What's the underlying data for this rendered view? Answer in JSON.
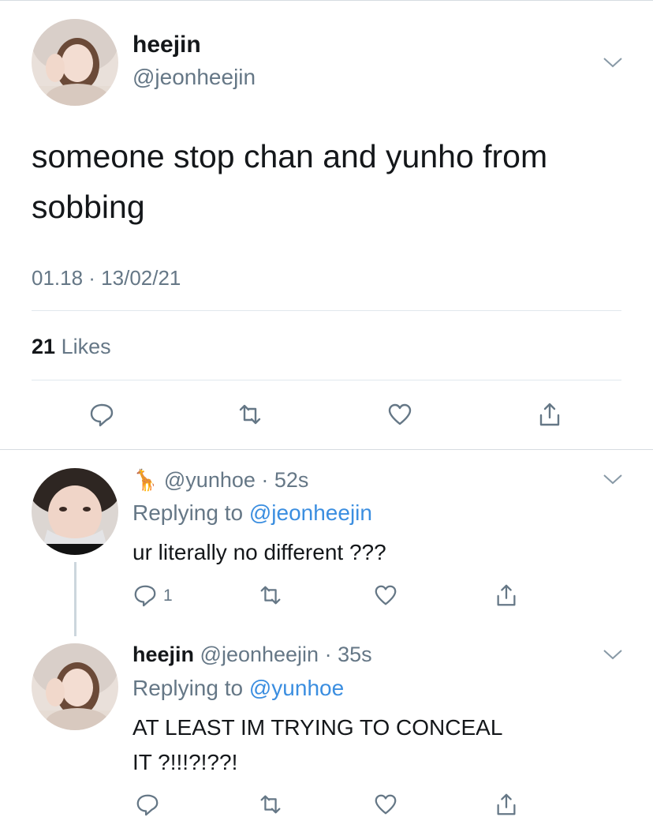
{
  "main_tweet": {
    "display_name": "heejin",
    "handle": "@jeonheejin",
    "text_line1": "someone stop chan and yunho from",
    "text_line2": "sobbing",
    "timestamp": "01.18 · 13/02/21",
    "likes_count": "21",
    "likes_label": "Likes"
  },
  "replies": [
    {
      "emoji": "🦒",
      "handle": "@yunhoe",
      "time": "· 52s",
      "replying_prefix": "Replying to",
      "replying_to": "@jeonheejin",
      "text_line1": "ur literally no different ???",
      "text_line2": "",
      "reply_count": "1"
    },
    {
      "display_name": "heejin",
      "handle": "@jeonheejin",
      "time": "· 35s",
      "replying_prefix": "Replying to",
      "replying_to": "@yunhoe",
      "text_line1": "AT LEAST IM TRYING TO CONCEAL",
      "text_line2": "IT ?!!!?!??!"
    }
  ],
  "icons": {
    "reply": "comment-icon",
    "retweet": "retweet-icon",
    "like": "heart-icon",
    "share": "share-icon",
    "menu": "chevron-down-icon"
  },
  "colors": {
    "text": "#14171a",
    "muted": "#657786",
    "link": "#3b8ee0",
    "divider": "#e1e8ed"
  }
}
